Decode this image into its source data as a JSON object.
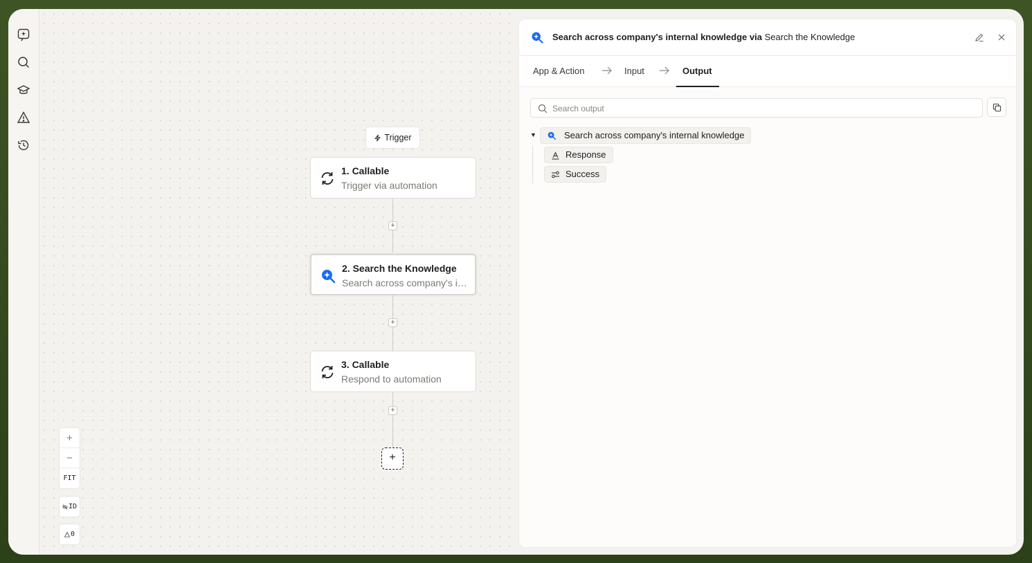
{
  "colors": {
    "accent": "#1a6cf0",
    "frame": "#3e5424"
  },
  "canvas": {
    "trigger_chip": "Trigger",
    "nodes": [
      {
        "title": "1. Callable",
        "subtitle": "Trigger via automation",
        "icon": "refresh-icon"
      },
      {
        "title": "2. Search the Knowledge",
        "subtitle": "Search across company's internal knowledge",
        "icon": "search-knowledge-icon",
        "selected": true
      },
      {
        "title": "3. Callable",
        "subtitle": "Respond to automation",
        "icon": "refresh-icon"
      }
    ],
    "add_step": "+",
    "zoom": {
      "in": "+",
      "out": "−",
      "fit": "FIT"
    },
    "id_toggle": "ID",
    "warnings_count": "0"
  },
  "panel": {
    "title_action": "Search across company's internal knowledge via",
    "title_app": "Search the Knowledge",
    "tabs": [
      {
        "label": "App & Action"
      },
      {
        "label": "Input"
      },
      {
        "label": "Output",
        "active": true
      }
    ],
    "search_placeholder": "Search output",
    "tree": {
      "root_label": "Search across company's internal knowledge",
      "children": [
        {
          "label": "Response",
          "icon": "text-type-icon"
        },
        {
          "label": "Success",
          "icon": "toggle-icon"
        }
      ]
    }
  }
}
